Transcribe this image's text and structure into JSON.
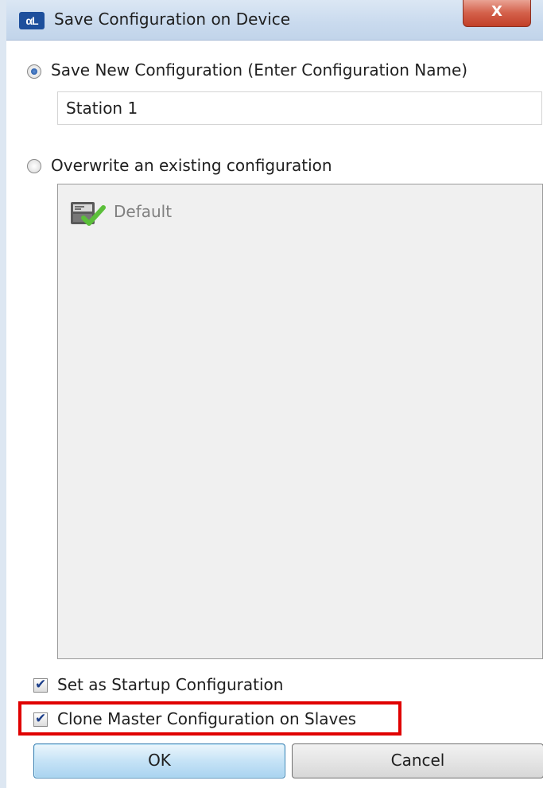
{
  "window": {
    "title": "Save Configuration on Device",
    "app_icon_text": "αL",
    "close_label": "X"
  },
  "save_new": {
    "label": "Save New Configuration (Enter Configuration Name)",
    "selected": true,
    "input_value": "Station 1"
  },
  "overwrite": {
    "label": "Overwrite an existing configuration",
    "selected": false,
    "items": [
      {
        "label": "Default",
        "icon": "configuration-check-icon"
      }
    ]
  },
  "options": {
    "startup_label": "Set as Startup Configuration",
    "startup_checked": true,
    "clone_label": "Clone Master Configuration on Slaves",
    "clone_checked": true,
    "check_glyph": "✔"
  },
  "buttons": {
    "ok_label": "OK",
    "cancel_label": "Cancel"
  },
  "colors": {
    "highlight": "#e00000",
    "ok_border": "#3c7fb1"
  }
}
